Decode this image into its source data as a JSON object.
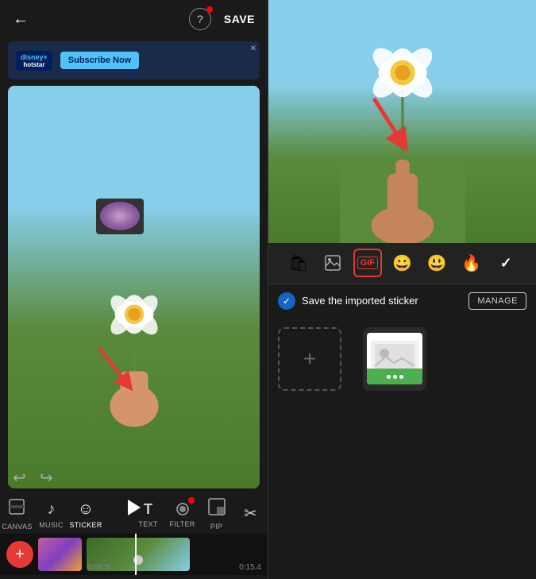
{
  "left": {
    "back_label": "←",
    "help_label": "?",
    "save_label": "SAVE",
    "ad": {
      "brand": "disney+",
      "sub_brand": "hotstar",
      "cta": "Subscribe Now",
      "close": "✕"
    },
    "tools": [
      {
        "id": "canvas",
        "icon": "⬜",
        "label": "CANVAS"
      },
      {
        "id": "music",
        "icon": "♪",
        "label": "MUSIC"
      },
      {
        "id": "sticker",
        "icon": "☺",
        "label": "STICKER",
        "active": true
      },
      {
        "id": "text",
        "icon": "T",
        "label": "TEXT"
      },
      {
        "id": "filter",
        "icon": "●",
        "label": "FILTER",
        "has_dot": true
      },
      {
        "id": "pip",
        "icon": "▣",
        "label": "PIP"
      },
      {
        "id": "more",
        "icon": "✂",
        "label": ""
      }
    ],
    "timeline": {
      "time1": "0:06.5",
      "time2": "0:15.4",
      "add_label": "+"
    }
  },
  "right": {
    "sticker_toolbar": [
      {
        "id": "sticker-pack",
        "icon": "🛍",
        "label": "sticker-pack"
      },
      {
        "id": "image",
        "icon": "🖼",
        "label": "image",
        "active": true
      },
      {
        "id": "gif",
        "icon": "GIF",
        "label": "gif",
        "is_gif": true
      },
      {
        "id": "emoji1",
        "icon": "😀",
        "label": "emoji"
      },
      {
        "id": "emoji2",
        "icon": "😃",
        "label": "emoji2"
      },
      {
        "id": "fire",
        "icon": "🔥",
        "label": "fire"
      },
      {
        "id": "check",
        "icon": "✓",
        "label": "check"
      }
    ],
    "save_sticker": {
      "text": "Save the imported sticker",
      "manage_label": "MANAGE"
    },
    "sticker_grid": {
      "add_label": "+",
      "has_item": true
    }
  }
}
